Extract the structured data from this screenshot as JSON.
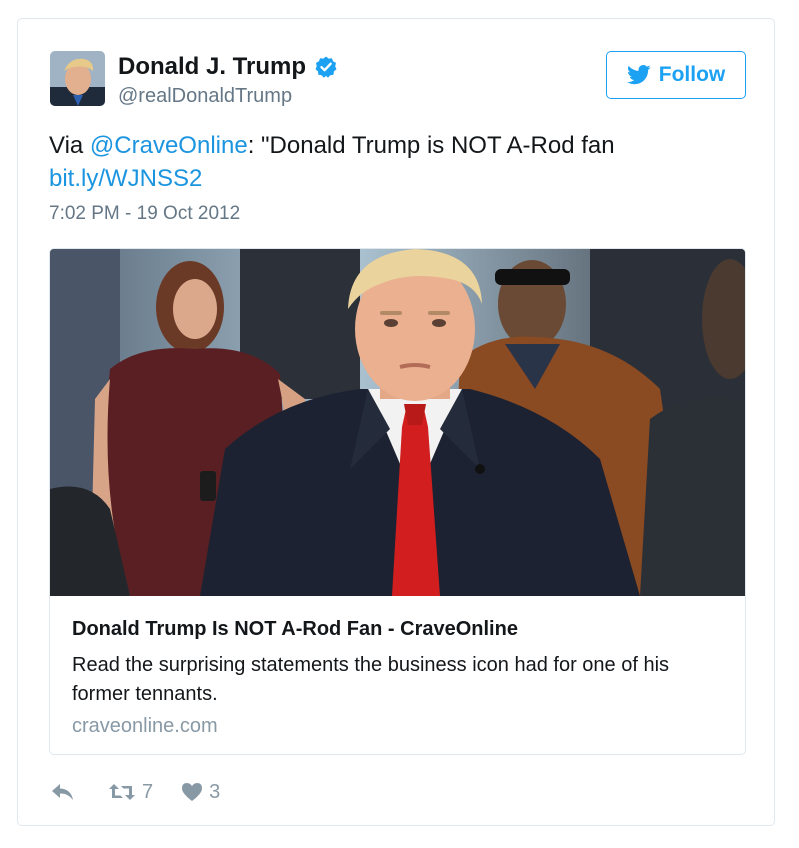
{
  "author": {
    "name": "Donald J. Trump",
    "handle": "@realDonaldTrump",
    "verified": true
  },
  "follow_button": {
    "label": "Follow",
    "icon": "twitter-bird-icon"
  },
  "tweet": {
    "prefix": "Via ",
    "mention": "@CraveOnline",
    "quote": ": \"Donald Trump is NOT A-Rod fan",
    "link": "bit.ly/WJNSS2",
    "timestamp": "7:02 PM - 19 Oct 2012"
  },
  "card": {
    "title": "Donald Trump Is NOT A-Rod Fan - CraveOnline",
    "description": "Read the surprising statements the business icon had for one of his former tennants.",
    "domain": "craveonline.com"
  },
  "actions": {
    "reply_icon": "reply-icon",
    "retweet_icon": "retweet-icon",
    "retweet_count": "7",
    "like_icon": "heart-icon",
    "like_count": "3"
  },
  "colors": {
    "link": "#1b95e0",
    "accent": "#1da1f2",
    "secondary_text": "#657786",
    "muted": "#8899a6",
    "border": "#e1e8ed"
  }
}
